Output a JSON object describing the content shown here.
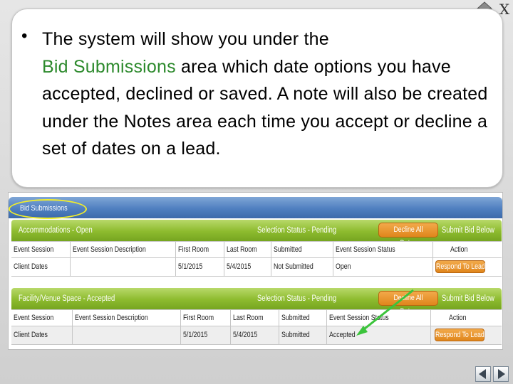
{
  "controls": {
    "close_label": "X"
  },
  "bullet": {
    "symbol": "•",
    "text_start": "The system will show you under the",
    "highlight": "Bid Submissions",
    "text_end": "area which date options you have accepted, declined or saved.  A note will also be created under the Notes area each time you accept or decline a set of dates on a lead."
  },
  "screenshot": {
    "section_title": "Bid Submissions",
    "panels": [
      {
        "title": "Accommodations - Open",
        "selection_status": "Selection Status - Pending",
        "decline_all_label": "Decline All Dates",
        "submit_label": "Submit Bid Below",
        "headers": [
          "Event Session",
          "Event Session Description",
          "First Room",
          "Last Room",
          "Submitted",
          "Event Session Status",
          "Action"
        ],
        "row": {
          "event_session": "Client Dates",
          "description": "",
          "first_room": "5/1/2015",
          "last_room": "5/4/2015",
          "submitted": "Not Submitted",
          "status": "Open",
          "action": "Respond To Lead"
        }
      },
      {
        "title": "Facility/Venue Space - Accepted",
        "selection_status": "Selection Status - Pending",
        "decline_all_label": "Decline All Dates",
        "submit_label": "Submit Bid Below",
        "headers": [
          "Event Session",
          "Event Session Description",
          "First Room",
          "Last Room",
          "Submitted",
          "Event Session Status",
          "Action"
        ],
        "row": {
          "event_session": "Client Dates",
          "description": "",
          "first_room": "5/1/2015",
          "last_room": "5/4/2015",
          "submitted": "Submitted",
          "status": "Accepted",
          "action": "Respond To Lead"
        }
      }
    ]
  },
  "colors": {
    "highlight_text": "#2d8a2d",
    "header_bar": "#4f7fc0",
    "panel_bar": "#8dbb2e",
    "action_button": "#e0861c",
    "annotation_ring": "#f2ee2a",
    "annotation_arrow": "#3cc43c"
  },
  "icons": {
    "home": "home-icon",
    "prev": "previous-slide-icon",
    "next": "next-slide-icon"
  }
}
